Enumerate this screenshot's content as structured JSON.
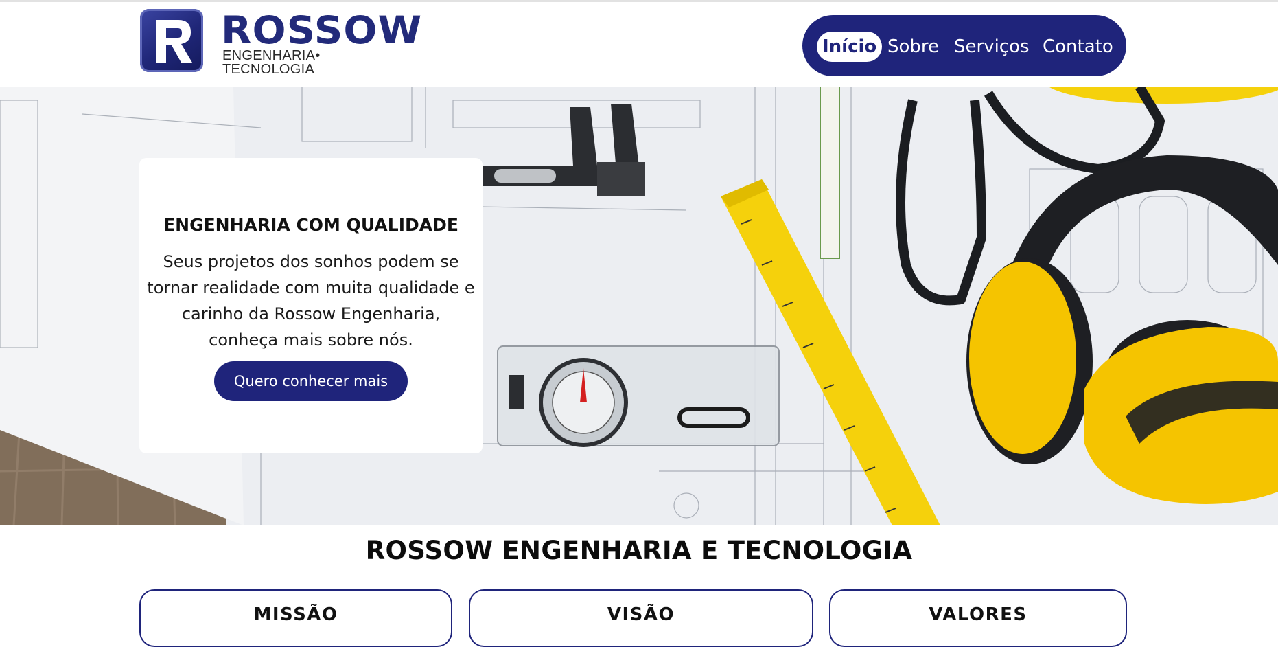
{
  "logo": {
    "letter": "R",
    "name": "ROSSOW",
    "tagline": "ENGENHARIA• TECNOLOGIA"
  },
  "nav": {
    "items": [
      {
        "label": "Início",
        "active": true
      },
      {
        "label": "Sobre",
        "active": false
      },
      {
        "label": "Serviços",
        "active": false
      },
      {
        "label": "Contato",
        "active": false
      }
    ]
  },
  "hero": {
    "title": "ENGENHARIA COM QUALIDADE",
    "text": "Seus projetos dos sonhos podem se tornar realidade com muita qualidade e carinho da Rossow Engenharia, conheça mais sobre nós.",
    "button_label": "Quero conhecer mais",
    "background_image": "engineering-tools-on-blueprint"
  },
  "section": {
    "title": "ROSSOW ENGENHARIA E TECNOLOGIA",
    "cards": [
      {
        "title": "MISSÃO"
      },
      {
        "title": "VISÃO"
      },
      {
        "title": "VALORES"
      }
    ]
  },
  "colors": {
    "brand_navy": "#1f247b",
    "accent_yellow": "#f5d10c",
    "background": "#ffffff"
  }
}
